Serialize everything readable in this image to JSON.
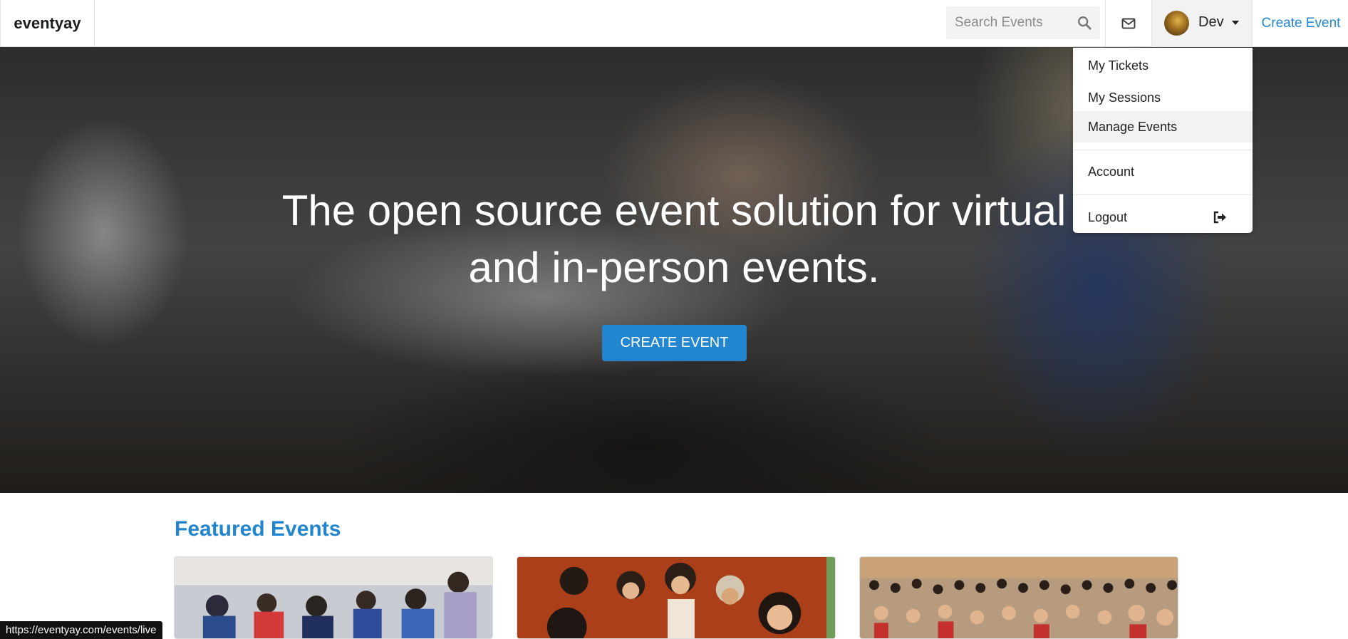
{
  "navbar": {
    "brand": "eventyay",
    "search_placeholder": "Search Events",
    "user_name": "Dev",
    "create_event_link": "Create Event",
    "icons": [
      "search-icon",
      "envelope-icon",
      "caret-down-icon"
    ]
  },
  "hero": {
    "title_line1": "The open source event solution for virtual",
    "title_line2": "and in-person events.",
    "cta_label": "CREATE EVENT"
  },
  "user_menu": {
    "items": [
      {
        "label": "My Tickets"
      },
      {
        "label": "My Sessions"
      },
      {
        "label": "Manage Events",
        "state": "hovered"
      },
      {
        "label": "Account"
      },
      {
        "label": "Logout",
        "icon": "sign-out-icon"
      }
    ]
  },
  "featured": {
    "heading": "Featured Events"
  },
  "status_bar": {
    "url": "https://eventyay.com/events/live"
  },
  "colors": {
    "accent": "#2185d0",
    "hover_bg": "#f2f2f2"
  }
}
